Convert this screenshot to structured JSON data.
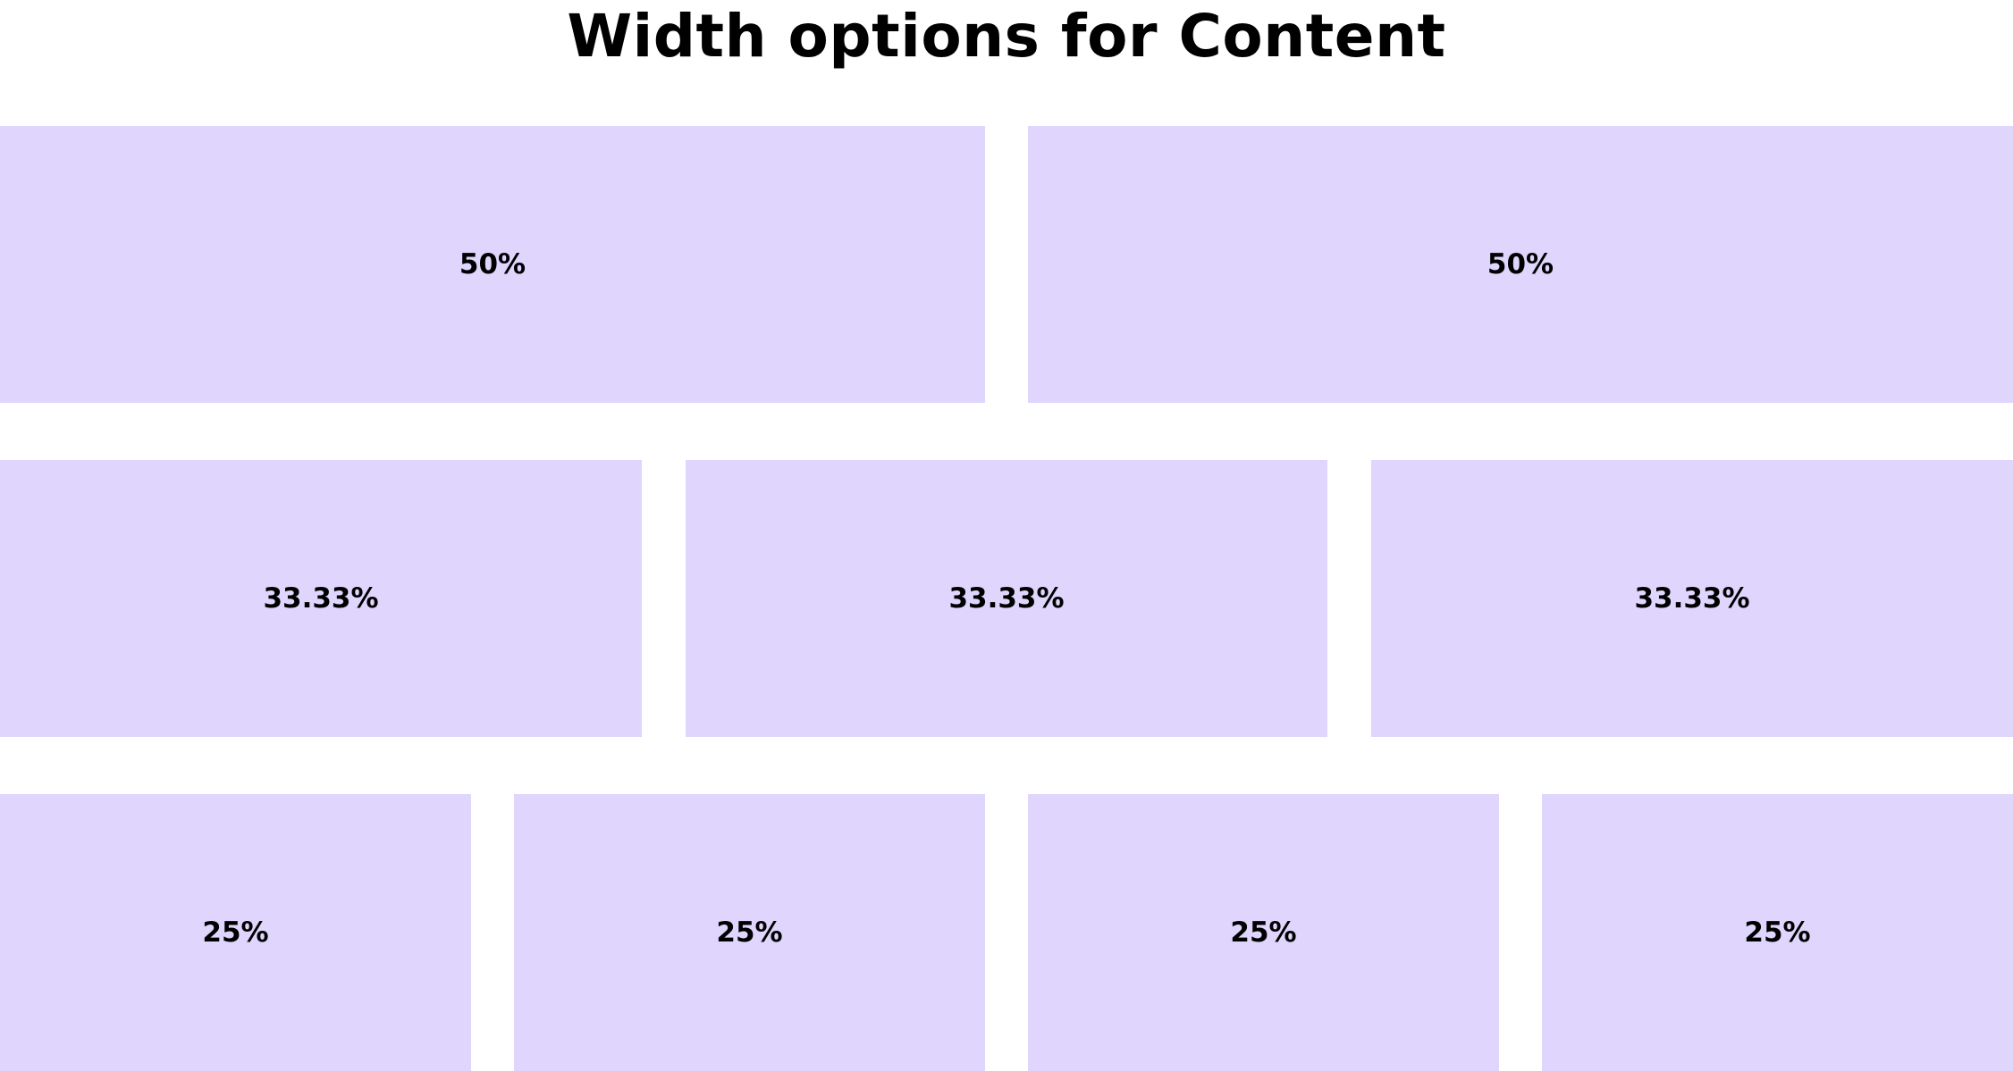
{
  "title": "Width options for Content",
  "colors": {
    "box_fill": "#dfd5fd",
    "text": "#000000",
    "background": "#ffffff"
  },
  "rows": [
    {
      "cells": [
        {
          "label": "50%"
        },
        {
          "label": "50%"
        }
      ]
    },
    {
      "cells": [
        {
          "label": "33.33%"
        },
        {
          "label": "33.33%"
        },
        {
          "label": "33.33%"
        }
      ]
    },
    {
      "cells": [
        {
          "label": "25%"
        },
        {
          "label": "25%"
        },
        {
          "label": "25%"
        },
        {
          "label": "25%"
        }
      ]
    }
  ]
}
